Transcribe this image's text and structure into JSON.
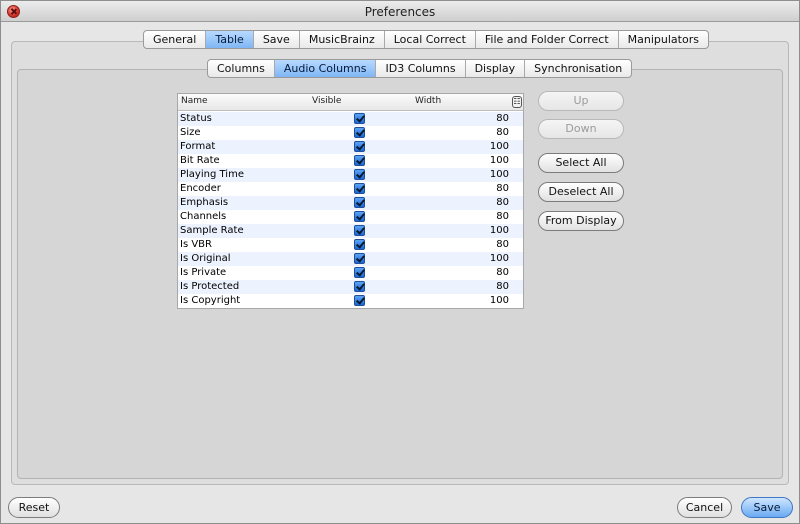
{
  "window": {
    "title": "Preferences"
  },
  "main_tabs": [
    "General",
    "Table",
    "Save",
    "MusicBrainz",
    "Local Correct",
    "File and Folder Correct",
    "Manipulators"
  ],
  "main_tab_active": "Table",
  "sub_tabs": [
    "Columns",
    "Audio Columns",
    "ID3 Columns",
    "Display",
    "Synchronisation"
  ],
  "sub_tab_active": "Audio Columns",
  "table": {
    "headers": {
      "name": "Name",
      "visible": "Visible",
      "width": "Width"
    },
    "rows": [
      {
        "name": "Status",
        "visible": true,
        "width": "80"
      },
      {
        "name": "Size",
        "visible": true,
        "width": "80"
      },
      {
        "name": "Format",
        "visible": true,
        "width": "100"
      },
      {
        "name": "Bit Rate",
        "visible": true,
        "width": "100"
      },
      {
        "name": "Playing Time",
        "visible": true,
        "width": "100"
      },
      {
        "name": "Encoder",
        "visible": true,
        "width": "80"
      },
      {
        "name": "Emphasis",
        "visible": true,
        "width": "80"
      },
      {
        "name": "Channels",
        "visible": true,
        "width": "80"
      },
      {
        "name": "Sample Rate",
        "visible": true,
        "width": "100"
      },
      {
        "name": "Is VBR",
        "visible": true,
        "width": "80"
      },
      {
        "name": "Is Original",
        "visible": true,
        "width": "100"
      },
      {
        "name": "Is Private",
        "visible": true,
        "width": "80"
      },
      {
        "name": "Is Protected",
        "visible": true,
        "width": "80"
      },
      {
        "name": "Is Copyright",
        "visible": true,
        "width": "100"
      }
    ]
  },
  "side_buttons": {
    "up": "Up",
    "down": "Down",
    "select_all": "Select All",
    "deselect_all": "Deselect All",
    "from_display": "From Display"
  },
  "bottom_buttons": {
    "reset": "Reset",
    "cancel": "Cancel",
    "save": "Save"
  },
  "colors": {
    "accent": "#7fb6f5",
    "checkbox": "#1c66d1",
    "stripe": "#edf3fe"
  },
  "icons": {
    "close": "close-icon",
    "column_chooser": "column-chooser-icon"
  }
}
